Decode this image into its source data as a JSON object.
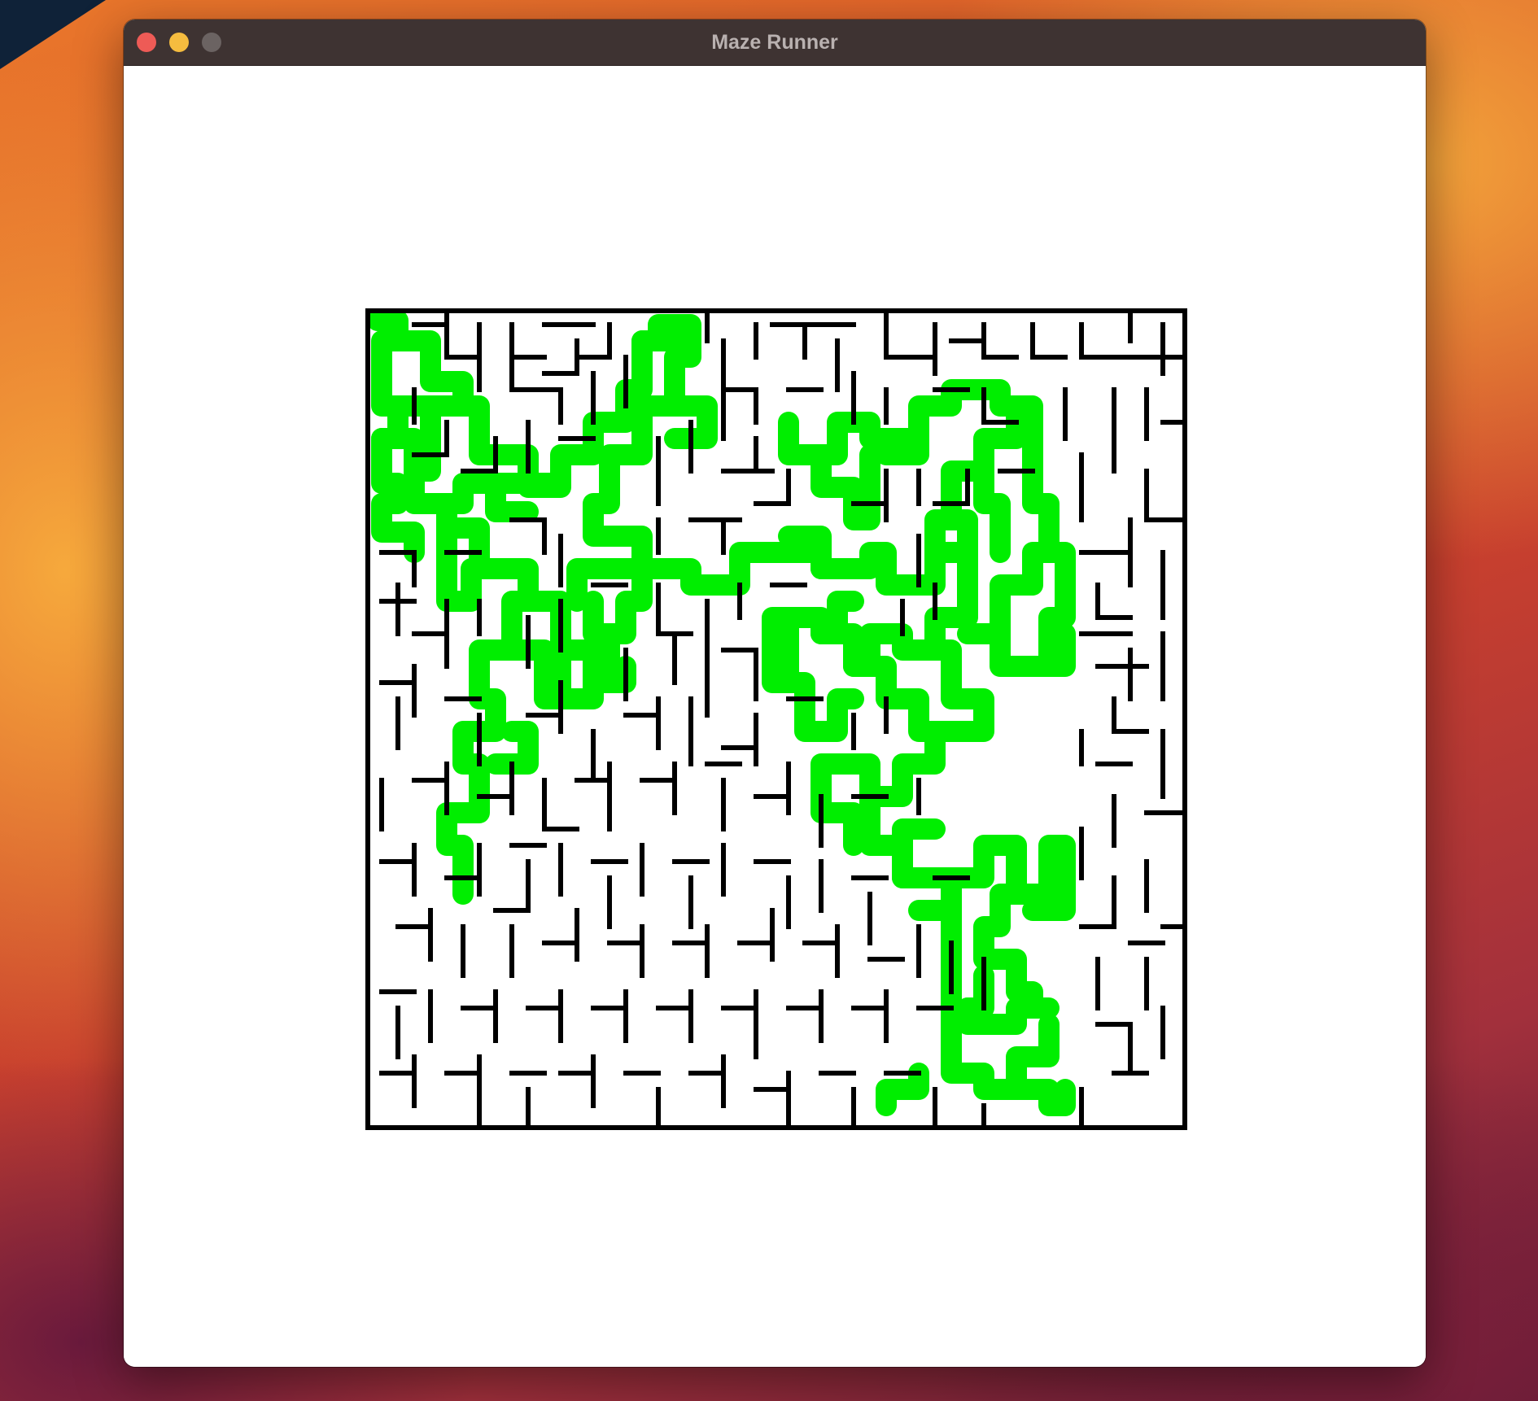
{
  "window": {
    "title": "Maze Runner"
  },
  "titlebar_buttons": {
    "close_color": "#ee5b56",
    "minimize_color": "#f5bc3f",
    "maximize_color": "#6b6362"
  },
  "maze": {
    "wall_color": "#000000",
    "path_color": "#00ee00",
    "background_color": "#ffffff",
    "solved": true
  }
}
